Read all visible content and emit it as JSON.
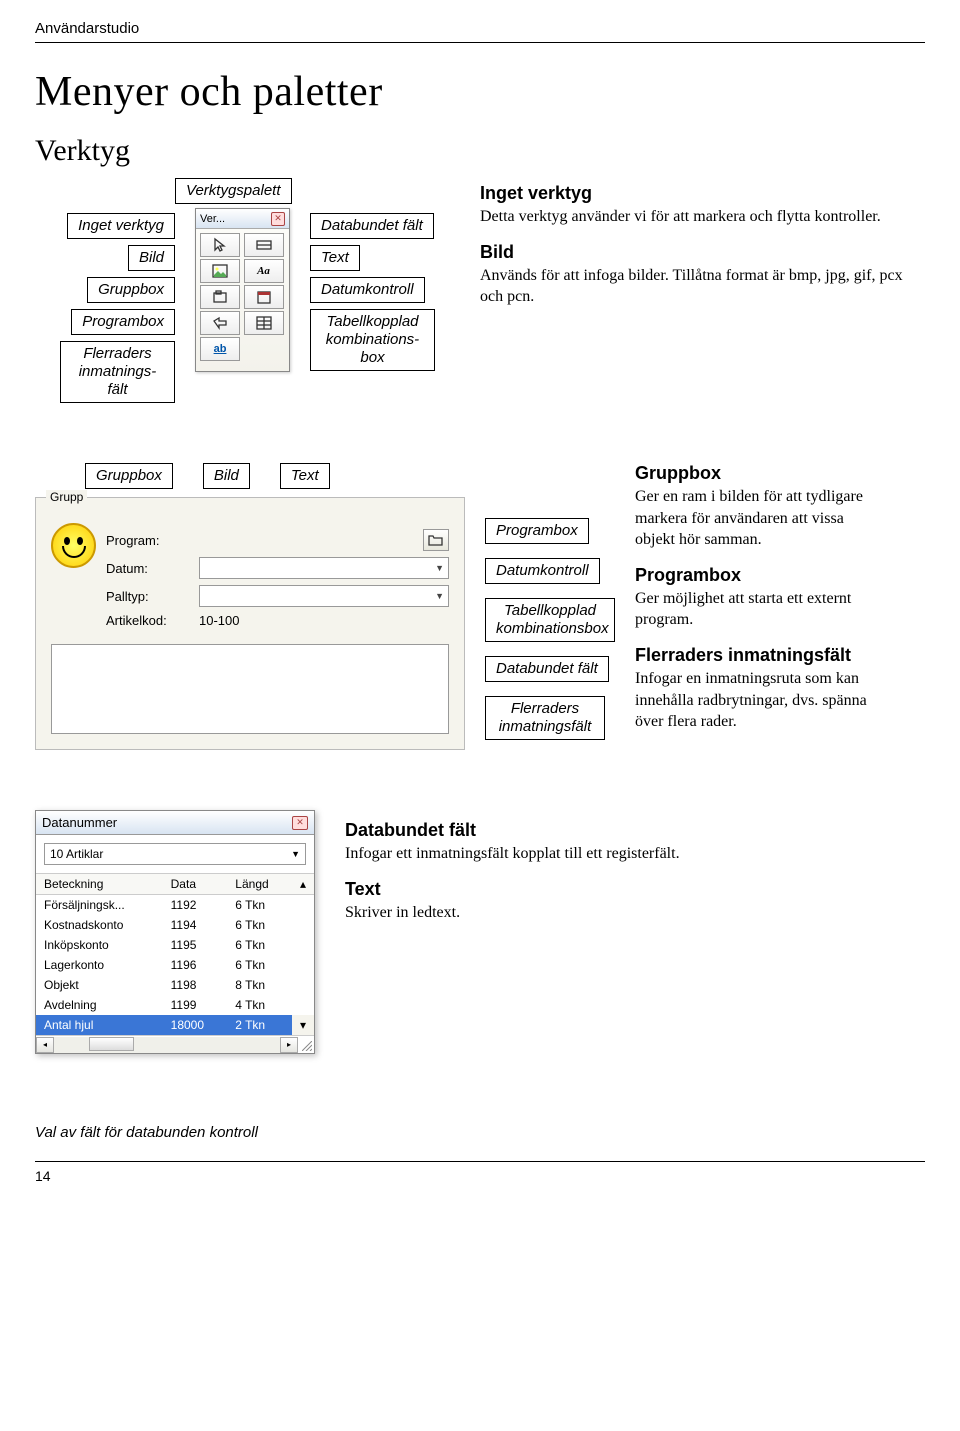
{
  "breadcrumb": "Användarstudio",
  "title": "Menyer och paletter",
  "subtitle": "Verktyg",
  "palette": {
    "title_label": "Verktygspalett",
    "window_title": "Ver...",
    "left_labels": [
      "Inget verktyg",
      "Bild",
      "Gruppbox",
      "Programbox",
      "Flerraders inmatnings-fält"
    ],
    "right_labels": [
      "Databundet fält",
      "Text",
      "Datumkontroll",
      "Tabellkopplad kombinations-box"
    ]
  },
  "desc1": {
    "h1": "Inget verktyg",
    "p1": "Detta verktyg använder vi för att markera och flytta kontroller.",
    "h2": "Bild",
    "p2": "Används för att infoga bilder. Tillåtna format är bmp, jpg, gif, pcx och pcn."
  },
  "section2": {
    "top_labels": [
      "Gruppbox",
      "Bild",
      "Text"
    ],
    "group_legend": "Grupp",
    "rows": {
      "program": "Program:",
      "datum": "Datum:",
      "palltyp": "Palltyp:",
      "artikelkod": "Artikelkod:",
      "artikelkod_val": "10-100"
    },
    "mid_labels": [
      "Programbox",
      "Datumkontroll",
      "Tabellkopplad kombinationsbox",
      "Databundet fält",
      "Flerraders inmatningsfält"
    ]
  },
  "desc2": {
    "h1": "Gruppbox",
    "p1": "Ger en ram i bilden för att tydligare markera för användaren att vissa objekt hör samman.",
    "h2": "Programbox",
    "p2": "Ger möjlighet att starta ett externt program.",
    "h3": "Flerraders inmatningsfält",
    "p3": "Infogar en inmatningsruta som kan innehålla radbrytningar, dvs. spänna över flera rader."
  },
  "datalist": {
    "title": "Datanummer",
    "dropdown": "10 Artiklar",
    "cols": [
      "Beteckning",
      "Data",
      "Längd"
    ],
    "rows": [
      [
        "Försäljningsk...",
        "1192",
        "6 Tkn"
      ],
      [
        "Kostnadskonto",
        "1194",
        "6 Tkn"
      ],
      [
        "Inköpskonto",
        "1195",
        "6 Tkn"
      ],
      [
        "Lagerkonto",
        "1196",
        "6 Tkn"
      ],
      [
        "Objekt",
        "1198",
        "8 Tkn"
      ],
      [
        "Avdelning",
        "1199",
        "4 Tkn"
      ],
      [
        "Antal hjul",
        "18000",
        "2 Tkn"
      ]
    ]
  },
  "desc3": {
    "h1": "Databundet fält",
    "p1": "Infogar ett inmatningsfält kopplat till ett registerfält.",
    "h2": "Text",
    "p2": "Skriver in ledtext."
  },
  "caption": "Val av fält för databunden kontroll",
  "pagenum": "14"
}
